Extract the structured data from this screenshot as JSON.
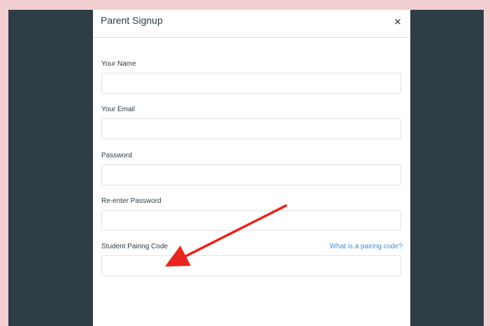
{
  "dialog": {
    "title": "Parent Signup",
    "close_icon": "close-icon"
  },
  "form": {
    "name_label": "Your Name",
    "email_label": "Your Email",
    "password_label": "Password",
    "reenter_label": "Re-enter Password",
    "pairing_label": "Student Pairing Code",
    "pairing_help_link": "What is a pairing code?",
    "name_value": "",
    "email_value": "",
    "password_value": "",
    "reenter_value": "",
    "pairing_value": ""
  },
  "annotation": {
    "arrow_color": "#e8251f"
  },
  "colors": {
    "page_background": "#f2cfd1",
    "backdrop": "#2f3d47",
    "link": "#3b8fd8"
  }
}
